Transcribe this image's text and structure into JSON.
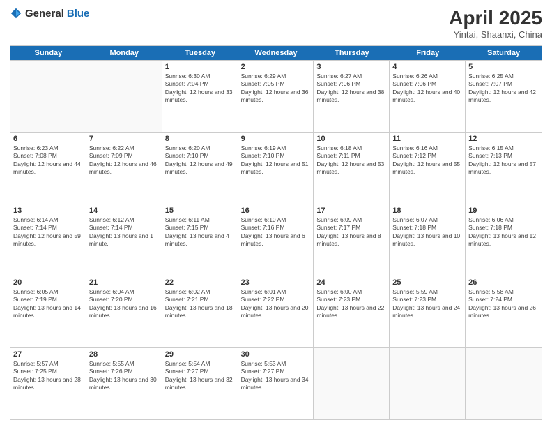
{
  "logo": {
    "general": "General",
    "blue": "Blue"
  },
  "title": "April 2025",
  "location": "Yintai, Shaanxi, China",
  "days_of_week": [
    "Sunday",
    "Monday",
    "Tuesday",
    "Wednesday",
    "Thursday",
    "Friday",
    "Saturday"
  ],
  "weeks": [
    [
      {
        "day": "",
        "sunrise": "",
        "sunset": "",
        "daylight": ""
      },
      {
        "day": "",
        "sunrise": "",
        "sunset": "",
        "daylight": ""
      },
      {
        "day": "1",
        "sunrise": "Sunrise: 6:30 AM",
        "sunset": "Sunset: 7:04 PM",
        "daylight": "Daylight: 12 hours and 33 minutes."
      },
      {
        "day": "2",
        "sunrise": "Sunrise: 6:29 AM",
        "sunset": "Sunset: 7:05 PM",
        "daylight": "Daylight: 12 hours and 36 minutes."
      },
      {
        "day": "3",
        "sunrise": "Sunrise: 6:27 AM",
        "sunset": "Sunset: 7:06 PM",
        "daylight": "Daylight: 12 hours and 38 minutes."
      },
      {
        "day": "4",
        "sunrise": "Sunrise: 6:26 AM",
        "sunset": "Sunset: 7:06 PM",
        "daylight": "Daylight: 12 hours and 40 minutes."
      },
      {
        "day": "5",
        "sunrise": "Sunrise: 6:25 AM",
        "sunset": "Sunset: 7:07 PM",
        "daylight": "Daylight: 12 hours and 42 minutes."
      }
    ],
    [
      {
        "day": "6",
        "sunrise": "Sunrise: 6:23 AM",
        "sunset": "Sunset: 7:08 PM",
        "daylight": "Daylight: 12 hours and 44 minutes."
      },
      {
        "day": "7",
        "sunrise": "Sunrise: 6:22 AM",
        "sunset": "Sunset: 7:09 PM",
        "daylight": "Daylight: 12 hours and 46 minutes."
      },
      {
        "day": "8",
        "sunrise": "Sunrise: 6:20 AM",
        "sunset": "Sunset: 7:10 PM",
        "daylight": "Daylight: 12 hours and 49 minutes."
      },
      {
        "day": "9",
        "sunrise": "Sunrise: 6:19 AM",
        "sunset": "Sunset: 7:10 PM",
        "daylight": "Daylight: 12 hours and 51 minutes."
      },
      {
        "day": "10",
        "sunrise": "Sunrise: 6:18 AM",
        "sunset": "Sunset: 7:11 PM",
        "daylight": "Daylight: 12 hours and 53 minutes."
      },
      {
        "day": "11",
        "sunrise": "Sunrise: 6:16 AM",
        "sunset": "Sunset: 7:12 PM",
        "daylight": "Daylight: 12 hours and 55 minutes."
      },
      {
        "day": "12",
        "sunrise": "Sunrise: 6:15 AM",
        "sunset": "Sunset: 7:13 PM",
        "daylight": "Daylight: 12 hours and 57 minutes."
      }
    ],
    [
      {
        "day": "13",
        "sunrise": "Sunrise: 6:14 AM",
        "sunset": "Sunset: 7:14 PM",
        "daylight": "Daylight: 12 hours and 59 minutes."
      },
      {
        "day": "14",
        "sunrise": "Sunrise: 6:12 AM",
        "sunset": "Sunset: 7:14 PM",
        "daylight": "Daylight: 13 hours and 1 minute."
      },
      {
        "day": "15",
        "sunrise": "Sunrise: 6:11 AM",
        "sunset": "Sunset: 7:15 PM",
        "daylight": "Daylight: 13 hours and 4 minutes."
      },
      {
        "day": "16",
        "sunrise": "Sunrise: 6:10 AM",
        "sunset": "Sunset: 7:16 PM",
        "daylight": "Daylight: 13 hours and 6 minutes."
      },
      {
        "day": "17",
        "sunrise": "Sunrise: 6:09 AM",
        "sunset": "Sunset: 7:17 PM",
        "daylight": "Daylight: 13 hours and 8 minutes."
      },
      {
        "day": "18",
        "sunrise": "Sunrise: 6:07 AM",
        "sunset": "Sunset: 7:18 PM",
        "daylight": "Daylight: 13 hours and 10 minutes."
      },
      {
        "day": "19",
        "sunrise": "Sunrise: 6:06 AM",
        "sunset": "Sunset: 7:18 PM",
        "daylight": "Daylight: 13 hours and 12 minutes."
      }
    ],
    [
      {
        "day": "20",
        "sunrise": "Sunrise: 6:05 AM",
        "sunset": "Sunset: 7:19 PM",
        "daylight": "Daylight: 13 hours and 14 minutes."
      },
      {
        "day": "21",
        "sunrise": "Sunrise: 6:04 AM",
        "sunset": "Sunset: 7:20 PM",
        "daylight": "Daylight: 13 hours and 16 minutes."
      },
      {
        "day": "22",
        "sunrise": "Sunrise: 6:02 AM",
        "sunset": "Sunset: 7:21 PM",
        "daylight": "Daylight: 13 hours and 18 minutes."
      },
      {
        "day": "23",
        "sunrise": "Sunrise: 6:01 AM",
        "sunset": "Sunset: 7:22 PM",
        "daylight": "Daylight: 13 hours and 20 minutes."
      },
      {
        "day": "24",
        "sunrise": "Sunrise: 6:00 AM",
        "sunset": "Sunset: 7:23 PM",
        "daylight": "Daylight: 13 hours and 22 minutes."
      },
      {
        "day": "25",
        "sunrise": "Sunrise: 5:59 AM",
        "sunset": "Sunset: 7:23 PM",
        "daylight": "Daylight: 13 hours and 24 minutes."
      },
      {
        "day": "26",
        "sunrise": "Sunrise: 5:58 AM",
        "sunset": "Sunset: 7:24 PM",
        "daylight": "Daylight: 13 hours and 26 minutes."
      }
    ],
    [
      {
        "day": "27",
        "sunrise": "Sunrise: 5:57 AM",
        "sunset": "Sunset: 7:25 PM",
        "daylight": "Daylight: 13 hours and 28 minutes."
      },
      {
        "day": "28",
        "sunrise": "Sunrise: 5:55 AM",
        "sunset": "Sunset: 7:26 PM",
        "daylight": "Daylight: 13 hours and 30 minutes."
      },
      {
        "day": "29",
        "sunrise": "Sunrise: 5:54 AM",
        "sunset": "Sunset: 7:27 PM",
        "daylight": "Daylight: 13 hours and 32 minutes."
      },
      {
        "day": "30",
        "sunrise": "Sunrise: 5:53 AM",
        "sunset": "Sunset: 7:27 PM",
        "daylight": "Daylight: 13 hours and 34 minutes."
      },
      {
        "day": "",
        "sunrise": "",
        "sunset": "",
        "daylight": ""
      },
      {
        "day": "",
        "sunrise": "",
        "sunset": "",
        "daylight": ""
      },
      {
        "day": "",
        "sunrise": "",
        "sunset": "",
        "daylight": ""
      }
    ]
  ]
}
